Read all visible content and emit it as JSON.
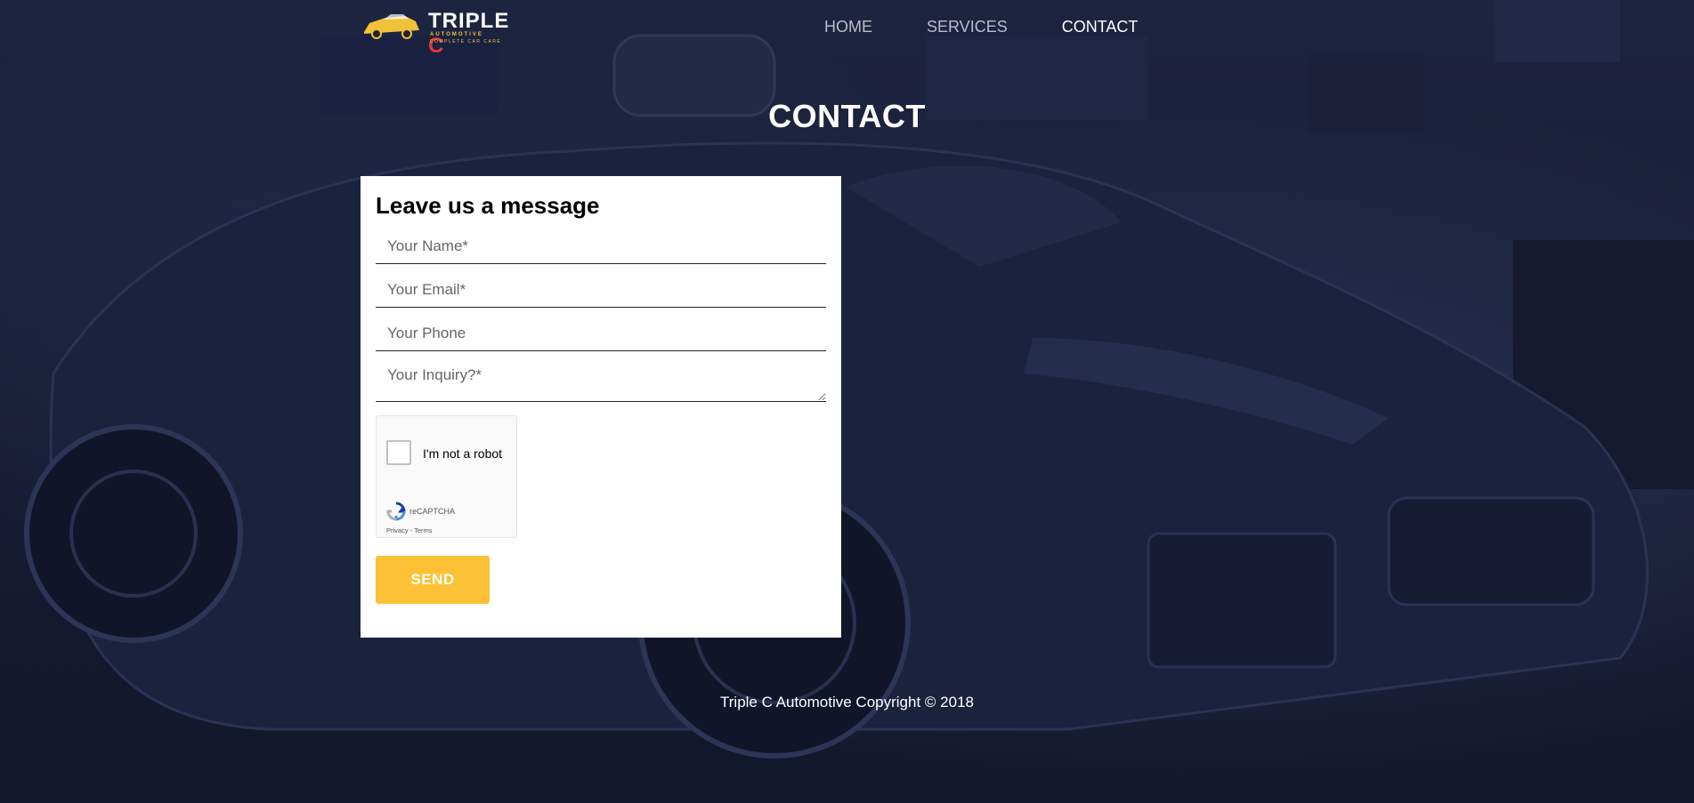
{
  "header": {
    "logo": {
      "brand_main": "TRIPLE",
      "brand_accent": "C",
      "sub": "AUTOMOTIVE",
      "tagline": "COMPLETE CAR CARE"
    },
    "nav": [
      {
        "label": "HOME",
        "active": false
      },
      {
        "label": "SERVICES",
        "active": false
      },
      {
        "label": "CONTACT",
        "active": true
      }
    ]
  },
  "page": {
    "title": "CONTACT"
  },
  "form": {
    "heading": "Leave us a message",
    "name": {
      "value": "",
      "placeholder": "Your Name*"
    },
    "email": {
      "value": "",
      "placeholder": "Your Email*"
    },
    "phone": {
      "value": "",
      "placeholder": "Your Phone"
    },
    "inquiry": {
      "value": "",
      "placeholder": "Your Inquiry?*"
    },
    "captcha": {
      "label": "I'm not a robot",
      "brand": "reCAPTCHA",
      "links": "Privacy - Terms",
      "checked": false
    },
    "submit_label": "SEND"
  },
  "footer": {
    "text": "Triple C Automotive Copyright © 2018"
  },
  "colors": {
    "accent": "#fcc134",
    "background": "#141a30",
    "card": "#ffffff"
  }
}
